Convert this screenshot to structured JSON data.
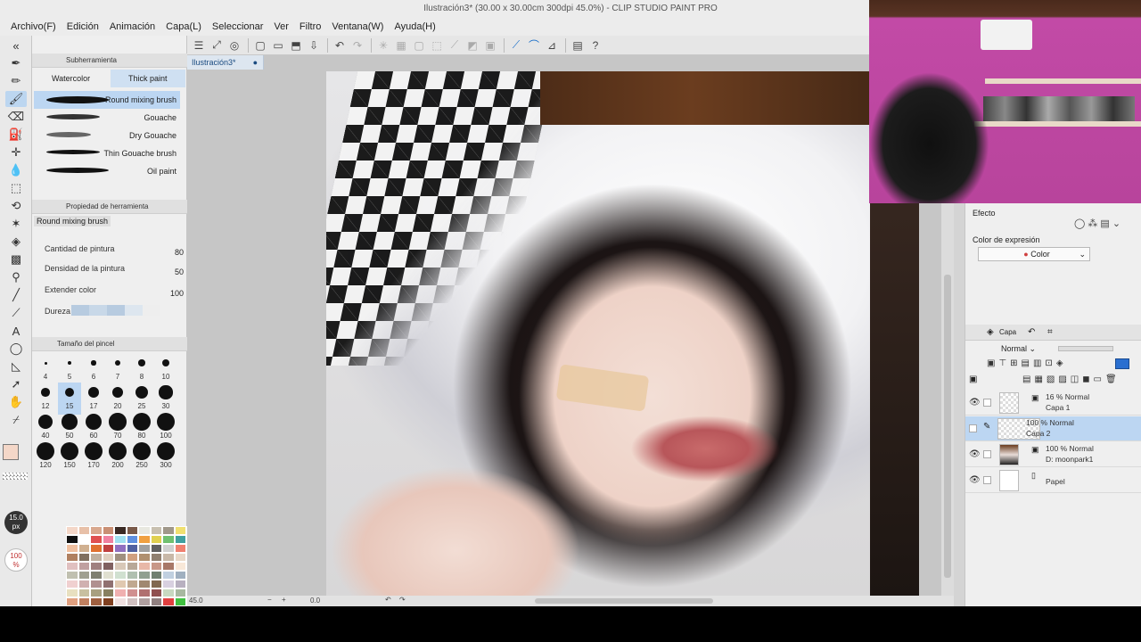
{
  "window": {
    "title": "Ilustración3* (30.00 x 30.00cm 300dpi 45.0%)  - CLIP STUDIO PAINT PRO"
  },
  "menu": [
    "Archivo(F)",
    "Edición",
    "Animación",
    "Capa(L)",
    "Seleccionar",
    "Ver",
    "Filtro",
    "Ventana(W)",
    "Ayuda(H)"
  ],
  "document_tab": {
    "label": "Ilustración3*"
  },
  "subtool_panel": {
    "title": "Subherramienta",
    "tabs": [
      "Watercolor",
      "Thick paint"
    ],
    "active_tab": "Thick paint",
    "brushes": [
      "Round mixing brush",
      "Gouache",
      "Dry Gouache",
      "Thin Gouache brush",
      "Oil paint"
    ],
    "selected_brush": "Round mixing brush"
  },
  "tool_property": {
    "title": "Propiedad de herramienta",
    "brush_name": "Round mixing brush",
    "props": [
      {
        "label": "Cantidad de pintura",
        "value": "80"
      },
      {
        "label": "Densidad de la pintura",
        "value": "50"
      },
      {
        "label": "Extender color",
        "value": "100"
      },
      {
        "label": "Dureza",
        "value": ""
      }
    ]
  },
  "brush_size": {
    "title": "Tamaño del pincel",
    "sizes": [
      "4",
      "5",
      "6",
      "7",
      "8",
      "10",
      "12",
      "15",
      "17",
      "20",
      "25",
      "30",
      "40",
      "50",
      "60",
      "70",
      "80",
      "100",
      "120",
      "150",
      "170",
      "200",
      "250",
      "300"
    ],
    "selected": "15"
  },
  "indicators": {
    "size": "15.0\npx",
    "opacity": "100\n%"
  },
  "palette_colors": [
    "#f4d7c8",
    "#e8c0a8",
    "#d9a88e",
    "#c98f74",
    "#3a2a24",
    "#7a5a4a",
    "#e8e8e0",
    "#c8c0b0",
    "#a0988a",
    "#f0e070",
    "#80c060",
    "#f0f0f0",
    "#111111",
    "#ffffff",
    "#e05050",
    "#f080a0",
    "#a0e0f0",
    "#6090e0",
    "#f0a040",
    "#e0d050",
    "#70c070",
    "#40a0a0",
    "#c05050",
    "#909090",
    "#f0c0a0",
    "#d0b090",
    "#e07030",
    "#c04040",
    "#9070c0",
    "#5060a0",
    "#a0a0a0",
    "#606060",
    "#d0d0d0",
    "#f08070",
    "#70a0d0",
    "#304080",
    "#b08060",
    "#807060",
    "#c0b0a0",
    "#e0d0c0",
    "#a09080",
    "#d0a080",
    "#b09070",
    "#908070",
    "#c8b8a8",
    "#e8d8c8",
    "#a88878",
    "#786858",
    "#e0c0c0",
    "#c0a0a0",
    "#a08080",
    "#806060",
    "#d8c8b8",
    "#b8a898",
    "#e8b8a8",
    "#c89888",
    "#a87868",
    "#f8e8d8",
    "#d8b8a8",
    "#b89888",
    "#c0c0b0",
    "#a0a090",
    "#808070",
    "#e0e0d0",
    "#d0e0d0",
    "#b0c0b0",
    "#90a090",
    "#708070",
    "#c0d0e0",
    "#a0b0c0",
    "#8090a0",
    "#607080",
    "#f0d0d0",
    "#d0b0b0",
    "#b09090",
    "#907070",
    "#e0c8b0",
    "#c0a890",
    "#a08870",
    "#806850",
    "#d8d0e0",
    "#b8b0c0",
    "#9890a0",
    "#787080",
    "#e8e0c0",
    "#c8c0a0",
    "#a8a080",
    "#888060",
    "#f0b0b0",
    "#d09090",
    "#b07070",
    "#905050",
    "#c8d8c0",
    "#a8b8a0",
    "#889880",
    "#687860",
    "#e0a080",
    "#c08060",
    "#a06040",
    "#804020",
    "#f0e0e0",
    "#d0c0c0",
    "#b0a0a0",
    "#908080",
    "#e04040",
    "#40c040",
    "#4040e0",
    "#e0e040",
    "#40e0e0",
    "#e040e0",
    "#c08040",
    "#8040c0",
    "#40c080",
    "#c04080",
    "#80c040",
    "#4080c0",
    "#f0f0e0",
    "#e0e0f0",
    "#f0e0f0",
    "#e0f0f0",
    "#f0f0d0",
    "#d0f0f0",
    "#f0d0f0",
    "#e8e8e8",
    "#c8c8c8",
    "#a8a8a8",
    "#888888",
    "#686868"
  ],
  "right_panel": {
    "effect_label": "Efecto",
    "expression_label": "Color de expresión",
    "expression_value": "Color",
    "layer_tab": "Capa",
    "blend_mode": "Normal",
    "layers": [
      {
        "mode": "16 % Normal",
        "name": "Capa 1",
        "visible": true,
        "selected": false
      },
      {
        "mode": "100 % Normal",
        "name": "Capa 2",
        "visible": false,
        "selected": true
      },
      {
        "mode": "100 % Normal",
        "name": "D: moonpark1",
        "visible": true,
        "selected": false
      },
      {
        "mode": "",
        "name": "Papel",
        "visible": true,
        "selected": false
      }
    ]
  },
  "status": {
    "zoom": "45.0",
    "angle": "0.0"
  },
  "colors": {
    "accent": "#1a6fc9",
    "selection": "#bcd6f2",
    "main_color": "#f4d7c8",
    "sub_color": "#111111"
  }
}
